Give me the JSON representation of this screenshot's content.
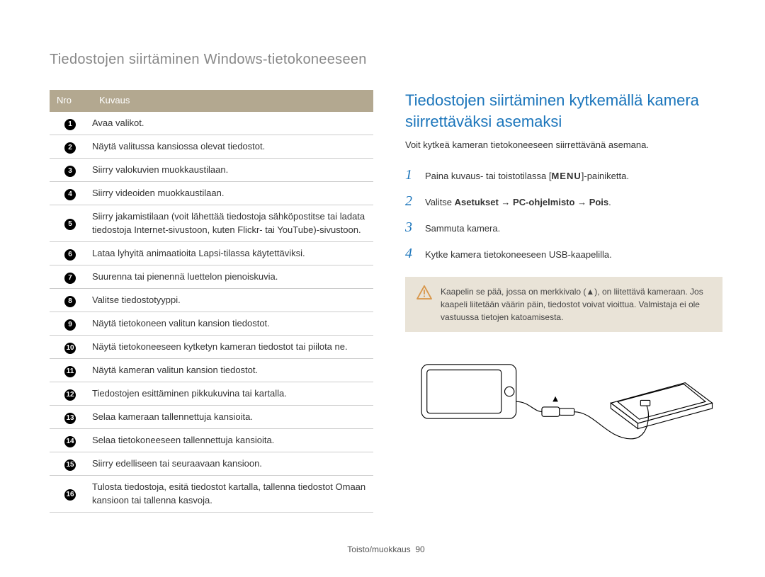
{
  "page_header": "Tiedostojen siirtäminen Windows-tietokoneeseen",
  "table": {
    "cols": [
      "Nro",
      "Kuvaus"
    ],
    "rows": [
      {
        "n": "1",
        "text": "Avaa valikot."
      },
      {
        "n": "2",
        "text": "Näytä valitussa kansiossa olevat tiedostot."
      },
      {
        "n": "3",
        "text": "Siirry valokuvien muokkaustilaan."
      },
      {
        "n": "4",
        "text": "Siirry videoiden muokkaustilaan."
      },
      {
        "n": "5",
        "text": "Siirry jakamistilaan (voit lähettää tiedostoja sähköpostitse tai ladata tiedostoja Internet-sivustoon, kuten Flickr- tai YouTube)-sivustoon."
      },
      {
        "n": "6",
        "text": "Lataa lyhyitä animaatioita Lapsi-tilassa käytettäviksi."
      },
      {
        "n": "7",
        "text": "Suurenna tai pienennä luettelon pienoiskuvia."
      },
      {
        "n": "8",
        "text": "Valitse tiedostotyyppi."
      },
      {
        "n": "9",
        "text": "Näytä tietokoneen valitun kansion tiedostot."
      },
      {
        "n": "10",
        "text": "Näytä tietokoneeseen kytketyn kameran tiedostot tai piilota ne."
      },
      {
        "n": "11",
        "text": "Näytä kameran valitun kansion tiedostot."
      },
      {
        "n": "12",
        "text": "Tiedostojen esittäminen pikkukuvina tai kartalla."
      },
      {
        "n": "13",
        "text": "Selaa kameraan tallennettuja kansioita."
      },
      {
        "n": "14",
        "text": "Selaa tietokoneeseen tallennettuja kansioita."
      },
      {
        "n": "15",
        "text": "Siirry edelliseen tai seuraavaan kansioon."
      },
      {
        "n": "16",
        "text": "Tulosta tiedostoja, esitä tiedostot kartalla, tallenna tiedostot Omaan kansioon tai tallenna kasvoja."
      }
    ]
  },
  "right": {
    "title": "Tiedostojen siirtäminen kytkemällä kamera siirrettäväksi asemaksi",
    "intro": "Voit kytkeä kameran tietokoneeseen siirrettävänä asemana.",
    "steps": [
      {
        "n": "1",
        "pre": "Paina kuvaus- tai toistotilassa [",
        "btn": "MENU",
        "post": "]-painiketta."
      },
      {
        "n": "2",
        "label": "Valitse",
        "bold1": "Asetukset",
        "bold2": "PC-ohjelmisto",
        "bold3": "Pois",
        "tail": "."
      },
      {
        "n": "3",
        "plain": "Sammuta kamera."
      },
      {
        "n": "4",
        "plain": "Kytke kamera tietokoneeseen USB-kaapelilla."
      }
    ],
    "note": "Kaapelin se pää, jossa on merkkivalo (▲), on liitettävä kameraan. Jos kaapeli liitetään väärin päin, tiedostot voivat vioittua. Valmistaja ei ole vastuussa tietojen katoamisesta."
  },
  "footer": {
    "section": "Toisto/muokkaus",
    "page": "90"
  }
}
